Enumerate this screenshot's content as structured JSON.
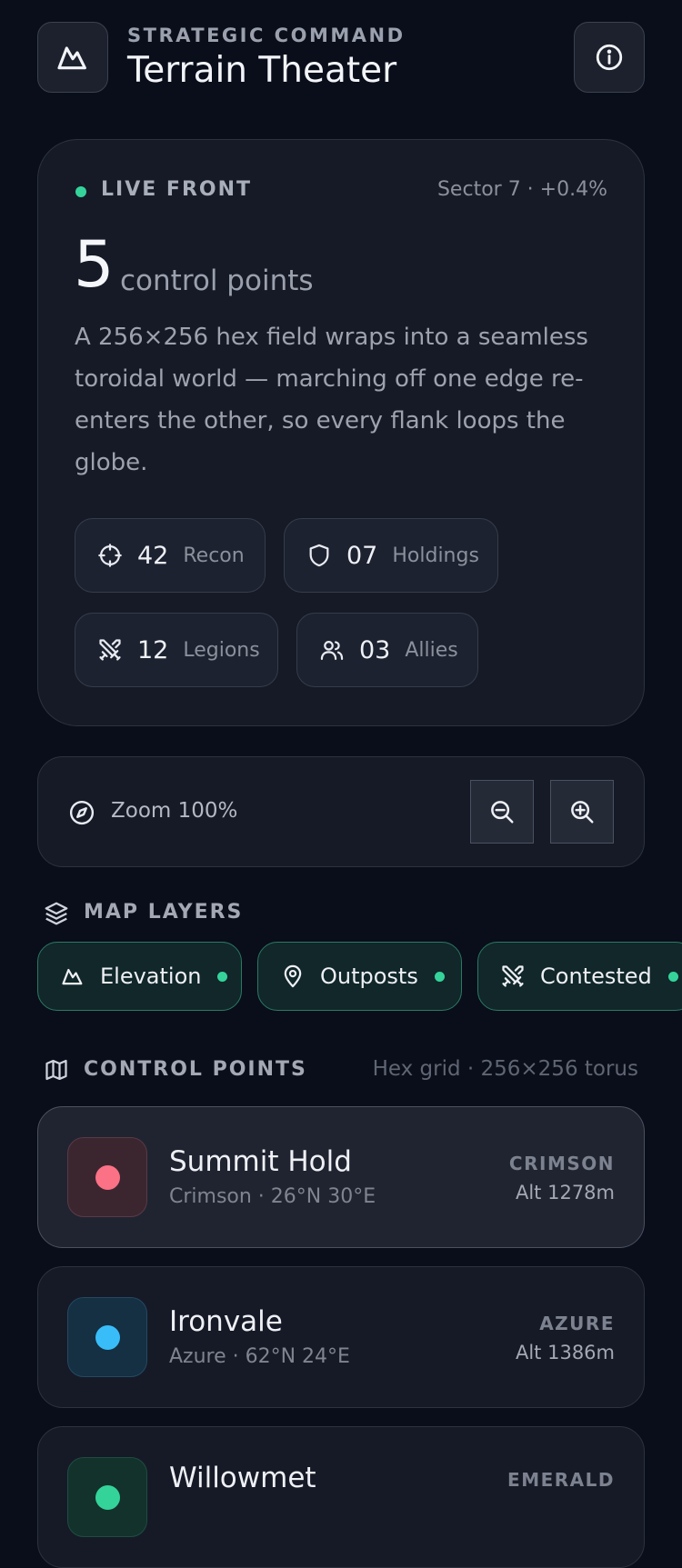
{
  "header": {
    "eyebrow": "STRATEGIC COMMAND",
    "title": "Terrain Theater"
  },
  "hero": {
    "status_label": "LIVE FRONT",
    "status_color": "#35d39a",
    "sector": "Sector 7 · +0.4%",
    "count": "5",
    "count_unit": "control points",
    "description": "A 256×256 hex field wraps into a seamless toroidal world — marching off one edge re-enters the other, so every flank loops the globe.",
    "stats": [
      {
        "icon": "crosshair-icon",
        "value": "42",
        "label": "Recon"
      },
      {
        "icon": "shield-icon",
        "value": "07",
        "label": "Holdings"
      },
      {
        "icon": "crossed-swords-icon",
        "value": "12",
        "label": "Legions"
      },
      {
        "icon": "users-icon",
        "value": "03",
        "label": "Allies"
      }
    ]
  },
  "zoom": {
    "label": "Zoom 100%"
  },
  "layers": {
    "title": "MAP LAYERS",
    "chips": [
      {
        "icon": "mountain-icon",
        "label": "Elevation",
        "active": true
      },
      {
        "icon": "map-pin-icon",
        "label": "Outposts",
        "active": true
      },
      {
        "icon": "crossed-swords-icon",
        "label": "Contested",
        "active": true
      }
    ]
  },
  "control_points": {
    "title": "CONTROL POINTS",
    "meta": "Hex grid · 256×256 torus",
    "items": [
      {
        "name": "Summit Hold",
        "sub": "Crimson · 26°N 30°E",
        "faction": "CRIMSON",
        "alt": "Alt 1278m",
        "color": "#fb7185",
        "selected": true
      },
      {
        "name": "Ironvale",
        "sub": "Azure · 62°N 24°E",
        "faction": "AZURE",
        "alt": "Alt 1386m",
        "color": "#38bdf8",
        "selected": false
      },
      {
        "name": "Willowmet",
        "sub": "",
        "faction": "EMERALD",
        "alt": "",
        "color": "#34d399",
        "selected": false
      }
    ]
  }
}
